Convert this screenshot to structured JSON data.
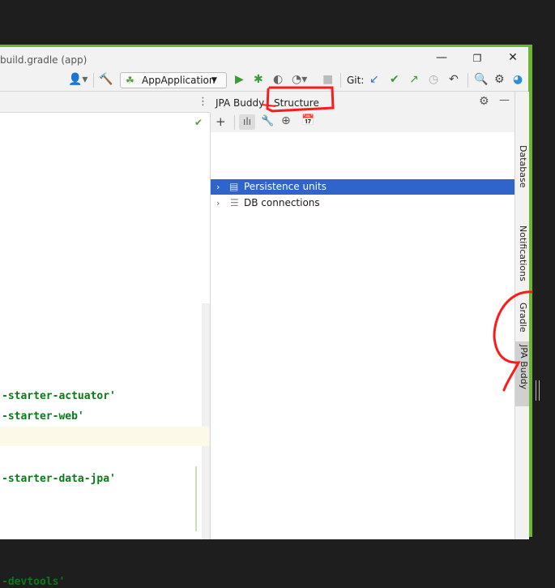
{
  "window": {
    "title": "build.gradle (app)",
    "minimize_glyph": "—",
    "restore_glyph": "❐",
    "close_glyph": "✕"
  },
  "toolbar": {
    "run_config": "AppApplication",
    "git_label": "Git:"
  },
  "editor": {
    "code_lines": [
      "-starter-actuator'",
      "-starter-web'",
      "-starter-data-jpa'",
      "-devtools'"
    ],
    "status_check": "✔"
  },
  "panel": {
    "tabs": [
      "JPA Buddy",
      "Structure"
    ],
    "tree": [
      {
        "label": "Persistence units",
        "selected": true
      },
      {
        "label": "DB connections",
        "selected": false
      }
    ]
  },
  "right_strip": {
    "items": [
      "Database",
      "Notifications",
      "Gradle",
      "JPA Buddy"
    ]
  },
  "colors": {
    "accent_green": "#6ab830",
    "selection_blue": "#2f65ca",
    "code_green": "#067d17",
    "annotation_red": "#ff1a1a"
  },
  "icons": {
    "add": "+",
    "gear": "⚙",
    "hide": "—",
    "menu": "⋮"
  }
}
